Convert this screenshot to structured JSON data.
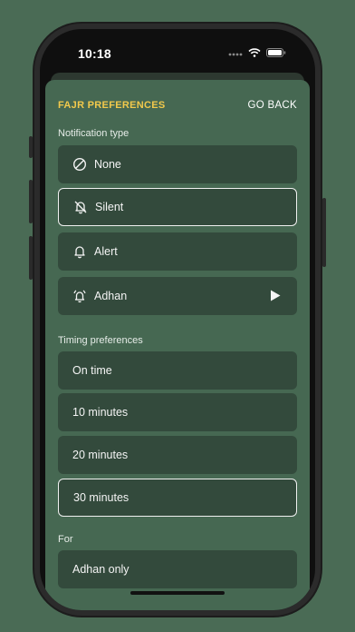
{
  "status": {
    "time": "10:18"
  },
  "header": {
    "title": "FAJR PREFERENCES",
    "back_label": "GO BACK"
  },
  "notification": {
    "label": "Notification type",
    "options": [
      {
        "label": "None",
        "icon": "no-entry-icon"
      },
      {
        "label": "Silent",
        "icon": "bell-off-icon",
        "selected": true
      },
      {
        "label": "Alert",
        "icon": "bell-icon"
      },
      {
        "label": "Adhan",
        "icon": "bell-ringing-icon",
        "action_icon": "play-icon"
      }
    ]
  },
  "timing": {
    "label": "Timing preferences",
    "options": [
      {
        "label": "On time"
      },
      {
        "label": "10 minutes"
      },
      {
        "label": "20 minutes"
      },
      {
        "label": "30 minutes",
        "selected": true
      }
    ]
  },
  "for": {
    "label": "For",
    "options": [
      {
        "label": "Adhan only"
      }
    ]
  },
  "colors": {
    "accent": "#f2c94c",
    "background": "#4a6b55",
    "sheet": "#466852",
    "option": "#334a3c"
  }
}
